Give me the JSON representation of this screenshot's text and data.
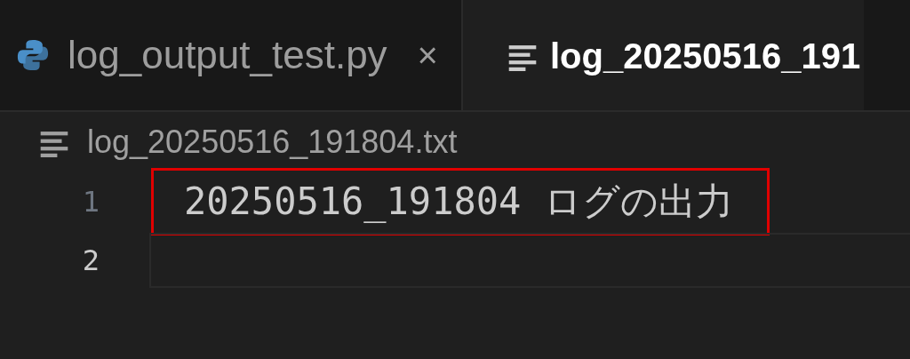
{
  "tabs": [
    {
      "label": "log_output_test.py",
      "kind": "python",
      "selected": false,
      "close": "×"
    },
    {
      "label": "log_20250516_191",
      "kind": "text",
      "selected": true
    }
  ],
  "breadcrumb": {
    "label": "log_20250516_191804.txt"
  },
  "editor": {
    "lines": [
      {
        "number": "1",
        "text": "20250516_191804 ログの出力",
        "current": false,
        "annotated": true
      },
      {
        "number": "2",
        "current": true,
        "annotated": false
      }
    ]
  }
}
